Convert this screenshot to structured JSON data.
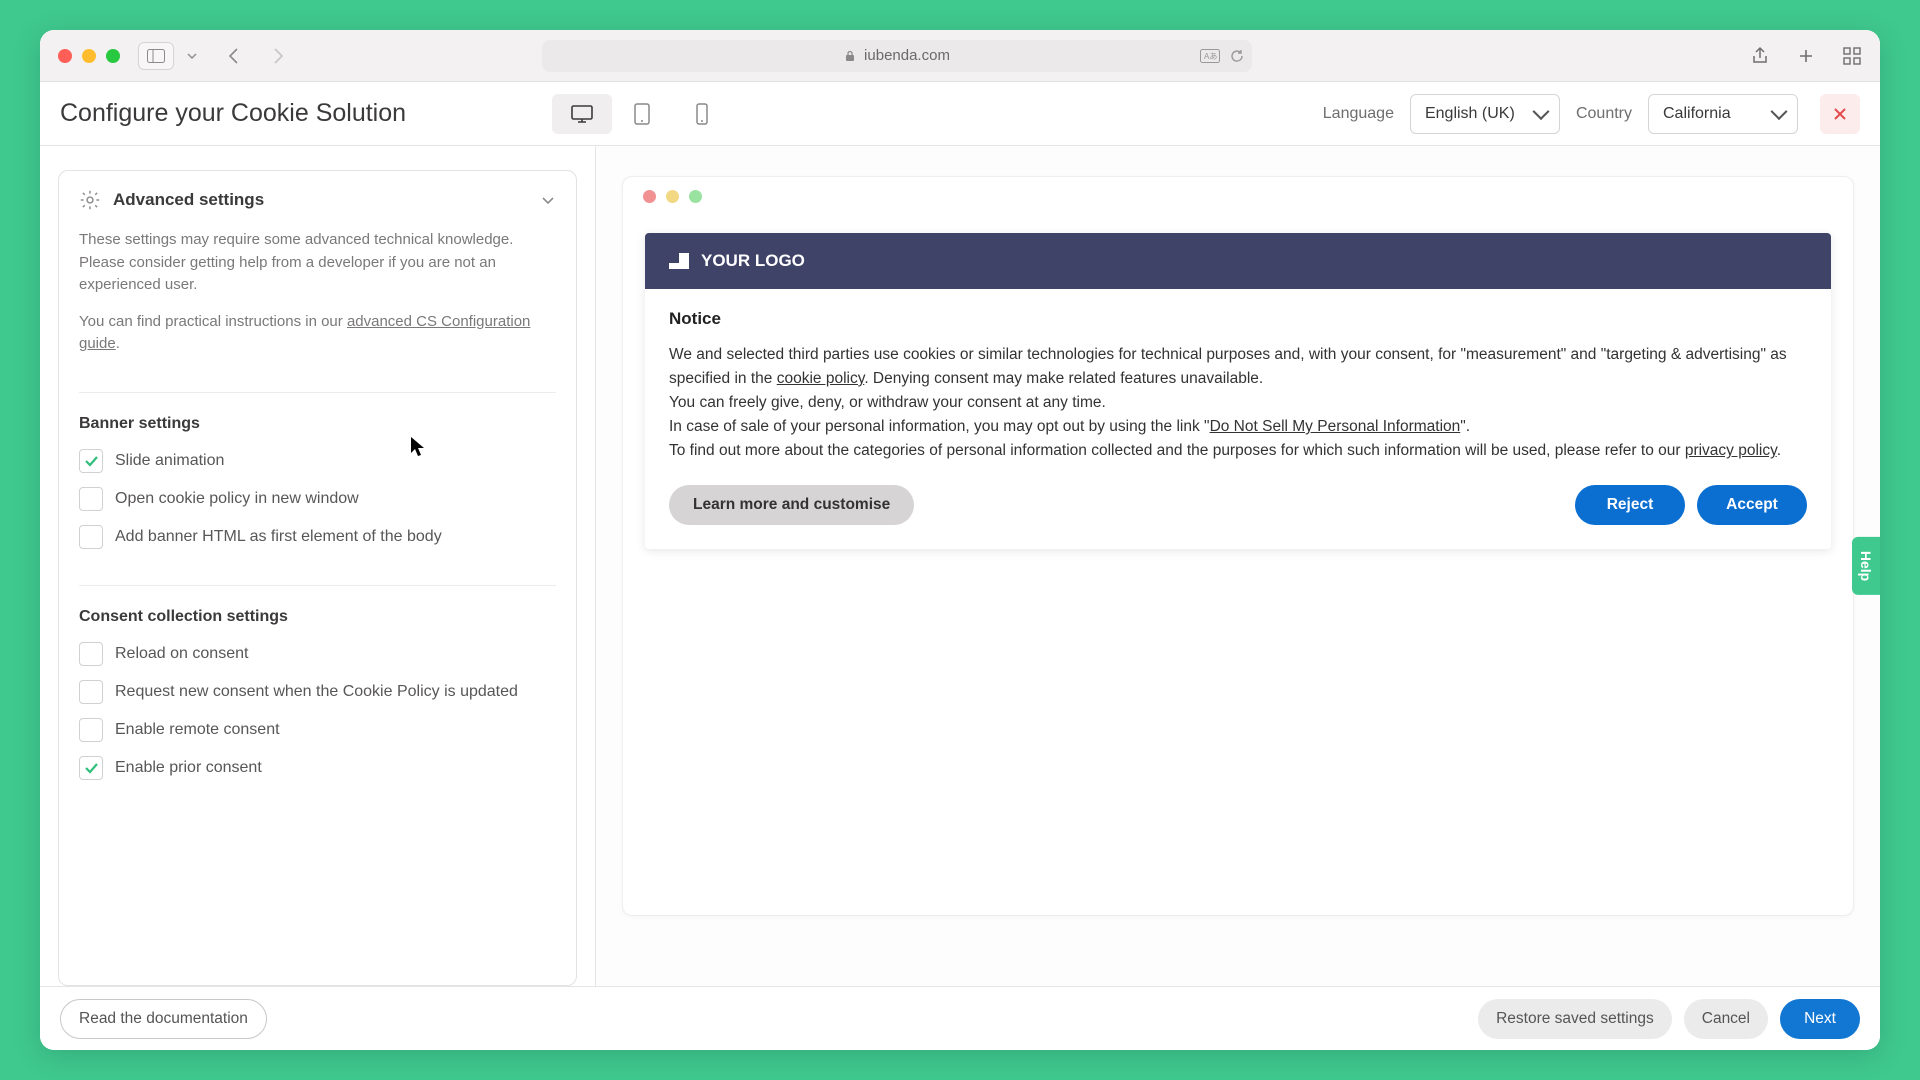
{
  "browser": {
    "url": "iubenda.com"
  },
  "header": {
    "title": "Configure your Cookie Solution",
    "language_label": "Language",
    "language_value": "English (UK)",
    "country_label": "Country",
    "country_value": "California"
  },
  "sidebar": {
    "section_title": "Advanced settings",
    "desc1": "These settings may require some advanced technical knowledge. Please consider getting help from a developer if you are not an experienced user.",
    "desc2_prefix": "You can find practical instructions in our ",
    "desc2_link": "advanced CS Configuration guide",
    "desc2_suffix": ".",
    "banner_title": "Banner settings",
    "banner_items": {
      "slide": "Slide animation",
      "newwin": "Open cookie policy in new window",
      "addhtml": "Add banner HTML as first element of the body"
    },
    "consent_title": "Consent collection settings",
    "consent_items": {
      "reload": "Reload on consent",
      "renew": "Request new consent when the Cookie Policy is updated",
      "remote": "Enable remote consent",
      "prior": "Enable prior consent"
    }
  },
  "preview": {
    "logo_text": "YOUR LOGO",
    "notice_title": "Notice",
    "p1a": "We and selected third parties use cookies or similar technologies for technical purposes and, with your consent, for \"measurement\" and \"targeting & advertising\" as specified in the ",
    "p1_cookie": "cookie policy",
    "p1b": ". Denying consent may make related features unavailable.",
    "p2": "You can freely give, deny, or withdraw your consent at any time.",
    "p3a": "In case of sale of your personal information, you may opt out by using the link \"",
    "p3_link": "Do Not Sell My Personal Information",
    "p3b": "\".",
    "p4a": "To find out more about the categories of personal information collected and the purposes for which such information will be used, please refer to our ",
    "p4_link": "privacy policy",
    "p4b": ".",
    "learn_btn": "Learn more and customise",
    "reject_btn": "Reject",
    "accept_btn": "Accept"
  },
  "help_tab": "Help",
  "footer": {
    "docs": "Read the documentation",
    "restore": "Restore saved settings",
    "cancel": "Cancel",
    "next": "Next"
  }
}
